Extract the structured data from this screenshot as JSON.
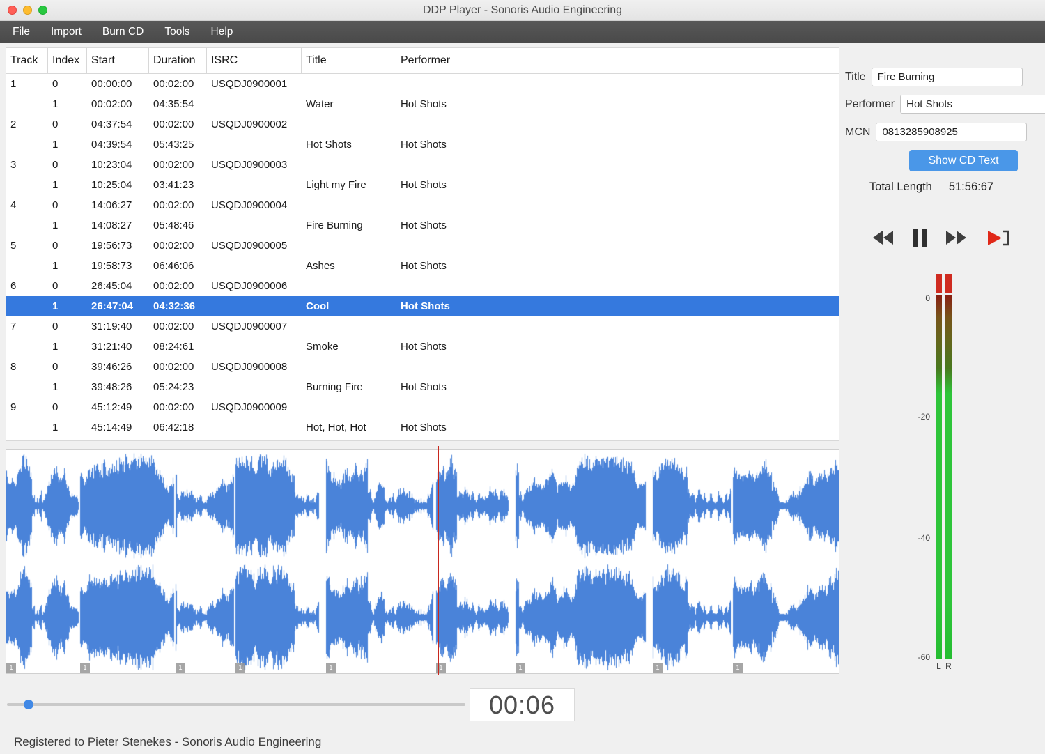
{
  "window": {
    "title": "DDP Player - Sonoris Audio Engineering"
  },
  "menu": {
    "items": [
      "File",
      "Import",
      "Burn CD",
      "Tools",
      "Help"
    ]
  },
  "table": {
    "columns": [
      "Track",
      "Index",
      "Start",
      "Duration",
      "ISRC",
      "Title",
      "Performer"
    ],
    "selected_row_index": 11,
    "rows": [
      {
        "track": "1",
        "index": "0",
        "start": "00:00:00",
        "duration": "00:02:00",
        "isrc": "USQDJ0900001",
        "title": "",
        "performer": ""
      },
      {
        "track": "",
        "index": "1",
        "start": "00:02:00",
        "duration": "04:35:54",
        "isrc": "",
        "title": "Water",
        "performer": "Hot Shots"
      },
      {
        "track": "2",
        "index": "0",
        "start": "04:37:54",
        "duration": "00:02:00",
        "isrc": "USQDJ0900002",
        "title": "",
        "performer": ""
      },
      {
        "track": "",
        "index": "1",
        "start": "04:39:54",
        "duration": "05:43:25",
        "isrc": "",
        "title": "Hot Shots",
        "performer": "Hot Shots"
      },
      {
        "track": "3",
        "index": "0",
        "start": "10:23:04",
        "duration": "00:02:00",
        "isrc": "USQDJ0900003",
        "title": "",
        "performer": ""
      },
      {
        "track": "",
        "index": "1",
        "start": "10:25:04",
        "duration": "03:41:23",
        "isrc": "",
        "title": "Light my Fire",
        "performer": "Hot Shots"
      },
      {
        "track": "4",
        "index": "0",
        "start": "14:06:27",
        "duration": "00:02:00",
        "isrc": "USQDJ0900004",
        "title": "",
        "performer": ""
      },
      {
        "track": "",
        "index": "1",
        "start": "14:08:27",
        "duration": "05:48:46",
        "isrc": "",
        "title": "Fire Burning",
        "performer": "Hot Shots"
      },
      {
        "track": "5",
        "index": "0",
        "start": "19:56:73",
        "duration": "00:02:00",
        "isrc": "USQDJ0900005",
        "title": "",
        "performer": ""
      },
      {
        "track": "",
        "index": "1",
        "start": "19:58:73",
        "duration": "06:46:06",
        "isrc": "",
        "title": "Ashes",
        "performer": "Hot Shots"
      },
      {
        "track": "6",
        "index": "0",
        "start": "26:45:04",
        "duration": "00:02:00",
        "isrc": "USQDJ0900006",
        "title": "",
        "performer": ""
      },
      {
        "track": "",
        "index": "1",
        "start": "26:47:04",
        "duration": "04:32:36",
        "isrc": "",
        "title": "Cool",
        "performer": "Hot Shots"
      },
      {
        "track": "7",
        "index": "0",
        "start": "31:19:40",
        "duration": "00:02:00",
        "isrc": "USQDJ0900007",
        "title": "",
        "performer": ""
      },
      {
        "track": "",
        "index": "1",
        "start": "31:21:40",
        "duration": "08:24:61",
        "isrc": "",
        "title": "Smoke",
        "performer": "Hot Shots"
      },
      {
        "track": "8",
        "index": "0",
        "start": "39:46:26",
        "duration": "00:02:00",
        "isrc": "USQDJ0900008",
        "title": "",
        "performer": ""
      },
      {
        "track": "",
        "index": "1",
        "start": "39:48:26",
        "duration": "05:24:23",
        "isrc": "",
        "title": "Burning Fire",
        "performer": "Hot Shots"
      },
      {
        "track": "9",
        "index": "0",
        "start": "45:12:49",
        "duration": "00:02:00",
        "isrc": "USQDJ0900009",
        "title": "",
        "performer": ""
      },
      {
        "track": "",
        "index": "1",
        "start": "45:14:49",
        "duration": "06:42:18",
        "isrc": "",
        "title": "Hot, Hot, Hot",
        "performer": "Hot Shots"
      }
    ]
  },
  "sidebar": {
    "title_label": "Title",
    "title_value": "Fire Burning",
    "performer_label": "Performer",
    "performer_value": "Hot Shots",
    "mcn_label": "MCN",
    "mcn_value": "0813285908925",
    "show_cd_text_label": "Show CD Text",
    "total_length_label": "Total Length",
    "total_length_value": "51:56:67",
    "meter": {
      "scale": [
        "0",
        "-20",
        "-40",
        "-60"
      ],
      "channels": [
        "L",
        "R"
      ]
    }
  },
  "player": {
    "time_display": "00:06"
  },
  "waveform": {
    "marker_label": "1"
  },
  "footer": {
    "registration": "Registered to Pieter Stenekes - Sonoris Audio Engineering"
  },
  "colors": {
    "selection": "#3579de",
    "accent_button": "#4a97e8",
    "waveform": "#4a83d9",
    "playhead": "#c8281e",
    "meter_red": "#cf2b20",
    "meter_green": "#2ec53a"
  }
}
